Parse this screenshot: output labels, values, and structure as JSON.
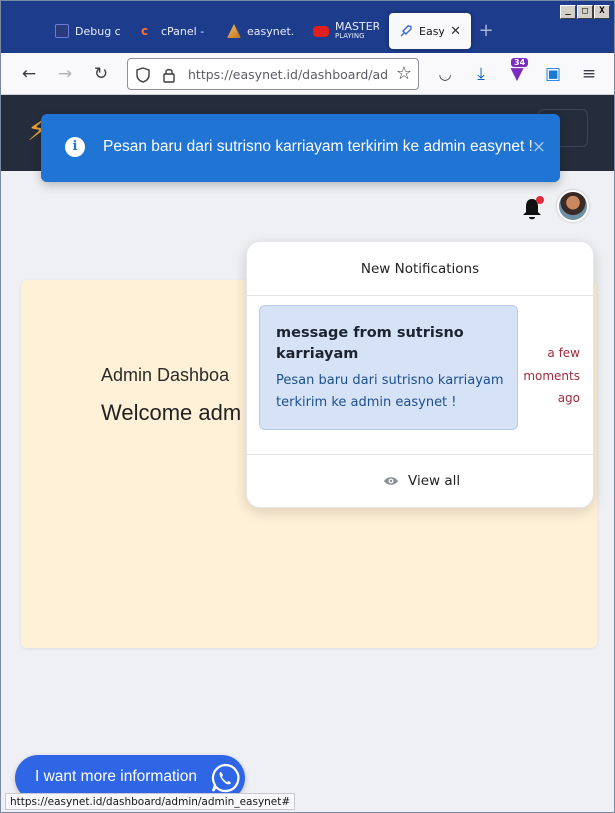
{
  "window": {
    "controls": [
      "_",
      "□",
      "X"
    ]
  },
  "tabs": [
    {
      "label": "Debug co",
      "icon": "debug-icon",
      "color": "#2a3a7a"
    },
    {
      "label": "cPanel - I",
      "icon": "cpanel-icon",
      "color": "#ff6c2c"
    },
    {
      "label": "easynet.",
      "icon": "easynet-icon",
      "color": "#e0a040"
    },
    {
      "label": "MASTER",
      "sub": "PLAYING",
      "icon": "youtube-icon",
      "color": "#e02020"
    },
    {
      "label": "EasyN",
      "icon": "rocket-icon",
      "color": "#3a6ad0",
      "active": true
    }
  ],
  "newtab_label": "+",
  "url": "https://easynet.id/dashboard/admin",
  "downloads_badge": "34",
  "toast": {
    "message": "Pesan baru dari sutrisno  karriayam terkirim ke admin easynet !",
    "close": "×",
    "info_glyph": "i",
    "color": "#1f74d4"
  },
  "header": {
    "notification_dot_color": "#e02c3c"
  },
  "dashboard": {
    "subtitle": "Admin Dashboa",
    "title": "Welcome adm"
  },
  "notifications": {
    "header": "New Notifications",
    "items": [
      {
        "title": "message from sutrisno karriayam",
        "body": "Pesan baru dari sutrisno karriayam terkirim ke admin easynet !",
        "time": "a few moments ago"
      }
    ],
    "view_all": "View all"
  },
  "whatsapp": {
    "label": "I want more information",
    "color": "#2f66e6"
  },
  "status_url": "https://easynet.id/dashboard/admin/admin_easynet#"
}
